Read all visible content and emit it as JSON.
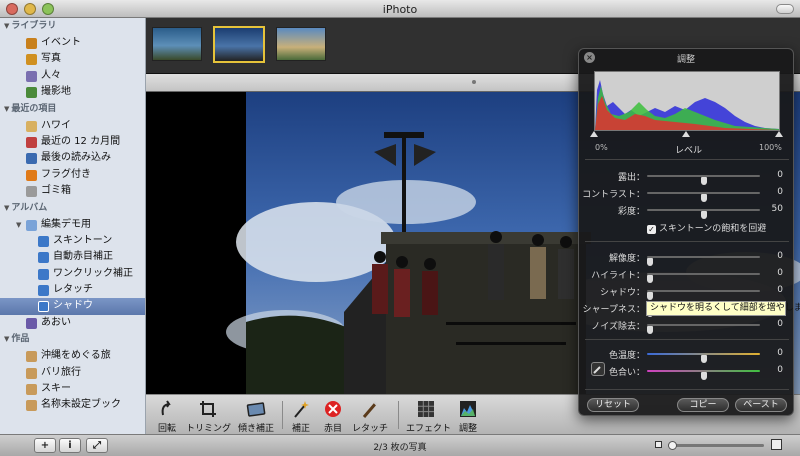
{
  "window": {
    "title": "iPhoto"
  },
  "sidebar": {
    "library_header": "ライブラリ",
    "library": [
      {
        "label": "イベント",
        "icon": "events-icon",
        "color": "#c8801c"
      },
      {
        "label": "写真",
        "icon": "photos-icon",
        "color": "#d09020"
      },
      {
        "label": "人々",
        "icon": "faces-icon",
        "color": "#7a6fb0"
      },
      {
        "label": "撮影地",
        "icon": "places-icon",
        "color": "#4a8a3a"
      }
    ],
    "recent_header": "最近の項目",
    "recent": [
      {
        "label": "ハワイ",
        "icon": "event-icon",
        "color": "#d8b060"
      },
      {
        "label": "最近の 12 カ月間",
        "icon": "calendar-icon",
        "color": "#c04040"
      },
      {
        "label": "最後の読み込み",
        "icon": "import-icon",
        "color": "#3a6ab0"
      },
      {
        "label": "フラグ付き",
        "icon": "flag-icon",
        "color": "#e07a18"
      },
      {
        "label": "ゴミ箱",
        "icon": "trash-icon",
        "color": "#9a9a9a"
      }
    ],
    "albums_header": "アルバム",
    "folder": "編集デモ用",
    "albums": [
      {
        "label": "スキントーン"
      },
      {
        "label": "自動赤目補正"
      },
      {
        "label": "ワンクリック補正"
      },
      {
        "label": "レタッチ"
      },
      {
        "label": "シャドウ",
        "selected": true
      }
    ],
    "other_album": "あおい",
    "projects_header": "作品",
    "projects": [
      {
        "label": "沖縄をめぐる旅"
      },
      {
        "label": "バリ旅行"
      },
      {
        "label": "スキー"
      },
      {
        "label": "名称未設定ブック"
      }
    ]
  },
  "toolbar": {
    "items": [
      {
        "label": "回転",
        "icon": "rotate-icon"
      },
      {
        "label": "トリミング",
        "icon": "crop-icon"
      },
      {
        "label": "傾き補正",
        "icon": "straighten-icon"
      },
      {
        "label": "補正",
        "icon": "enhance-icon"
      },
      {
        "label": "赤目",
        "icon": "red-eye-icon"
      },
      {
        "label": "レタッチ",
        "icon": "retouch-icon"
      },
      {
        "label": "エフェクト",
        "icon": "effects-icon"
      },
      {
        "label": "調整",
        "icon": "adjust-icon"
      }
    ]
  },
  "status": {
    "photo_count": "2/3 枚の写真"
  },
  "adjust": {
    "title": "調整",
    "hist_left": "0%",
    "hist_label": "レベル",
    "hist_right": "100%",
    "exposure": {
      "label": "露出：",
      "value": "0",
      "level": 0.5
    },
    "contrast": {
      "label": "コントラスト：",
      "value": "0",
      "level": 0.5
    },
    "saturation": {
      "label": "彩度：",
      "value": "50",
      "level": 0.5
    },
    "skin_checkbox": "スキントーンの飽和を回避",
    "definition": {
      "label": "解像度：",
      "value": "0",
      "level": 0.0
    },
    "highlights": {
      "label": "ハイライト：",
      "value": "0",
      "level": 0.0
    },
    "shadows": {
      "label": "シャドウ：",
      "value": "0",
      "level": 0.0
    },
    "sharpness": {
      "label": "シャープネス：",
      "value": "0",
      "level": 0.0
    },
    "noise": {
      "label": "ノイズ除去：",
      "value": "0",
      "level": 0.0
    },
    "temperature": {
      "label": "色温度：",
      "value": "0",
      "level": 0.5
    },
    "tint": {
      "label": "色合い：",
      "value": "0",
      "level": 0.5
    },
    "reset": "リセット",
    "copy": "コピー",
    "paste": "ペースト"
  },
  "tooltip": "シャドウを明るくして細部を増やします"
}
